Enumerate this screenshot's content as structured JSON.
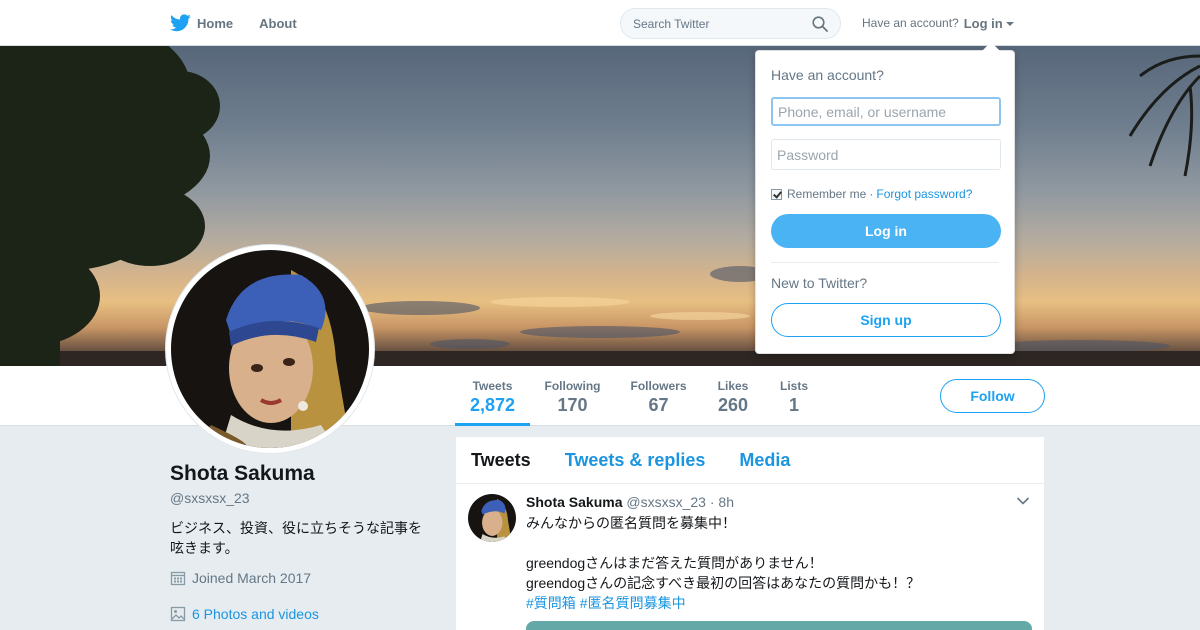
{
  "nav": {
    "home_label": "Home",
    "about_label": "About",
    "search_placeholder": "Search Twitter",
    "have_account": "Have an account?",
    "login_label": "Log in"
  },
  "login_dropdown": {
    "title": "Have an account?",
    "username_placeholder": "Phone, email, or username",
    "password_placeholder": "Password",
    "remember_me": "Remember me",
    "separator": "·",
    "forgot_password": "Forgot password?",
    "login_button": "Log in",
    "new_to_twitter": "New to Twitter?",
    "signup_button": "Sign up",
    "remember_checked": true
  },
  "stats": [
    {
      "label": "Tweets",
      "value": "2,872"
    },
    {
      "label": "Following",
      "value": "170"
    },
    {
      "label": "Followers",
      "value": "67"
    },
    {
      "label": "Likes",
      "value": "260"
    },
    {
      "label": "Lists",
      "value": "1"
    }
  ],
  "follow_button": "Follow",
  "profile": {
    "name": "Shota Sakuma",
    "handle": "@sxsxsx_23",
    "bio": "ビジネス、投資、役に立ちそうな記事を呟きます。",
    "joined": "Joined March 2017",
    "photos": "6 Photos and videos"
  },
  "timeline": {
    "tabs": [
      "Tweets",
      "Tweets & replies",
      "Media"
    ],
    "tweet": {
      "name": "Shota Sakuma",
      "handle": "@sxsxsx_23",
      "separator": "·",
      "time": "8h",
      "line1": "みんなからの匿名質問を募集中！",
      "line2": "greendogさんはまだ答えた質問がありません！",
      "line3": "greendogさんの記念すべき最初の回答はあなたの質問かも！？",
      "hashtag1": "#質問箱",
      "hashtag2": "#匿名質問募集中"
    }
  },
  "colors": {
    "accent": "#1da1f2",
    "link": "#1b95e0",
    "login_button": "#4ab3f4",
    "background": "#e6ecf0"
  },
  "icons": {
    "logo": "twitter-bird-icon",
    "search": "search-icon",
    "calendar": "calendar-icon",
    "photos": "photo-icon",
    "menu": "chevron-down-icon"
  }
}
